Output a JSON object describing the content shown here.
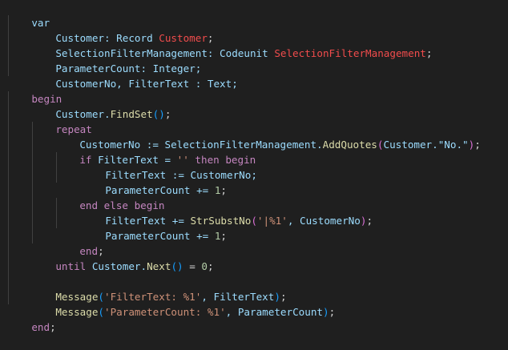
{
  "code": {
    "l1": {
      "var": "var"
    },
    "l2": {
      "a": "Customer: Record ",
      "b": "Customer",
      "c": ";"
    },
    "l3": {
      "a": "SelectionFilterManagement: Codeunit ",
      "b": "SelectionFilterManagement",
      "c": ";"
    },
    "l4": {
      "a": "ParameterCount: Integer;"
    },
    "l5": {
      "a": "CustomerNo, FilterText : Text;"
    },
    "l6": {
      "a": "begin"
    },
    "l7": {
      "a": "Customer.",
      "b": "FindSet",
      "c": "(",
      "d": ")",
      "e": ";"
    },
    "l8": {
      "a": "repeat"
    },
    "l9": {
      "a": "CustomerNo := SelectionFilterManagement.",
      "b": "AddQuotes",
      "c": "(",
      "d": "Customer.\"No.\"",
      "e": ")",
      "f": ";"
    },
    "l10": {
      "a": "if",
      "b": " FilterText = ",
      "c": "''",
      "d": " then ",
      "e": "begin"
    },
    "l11": {
      "a": "FilterText := CustomerNo;"
    },
    "l12": {
      "a": "ParameterCount += ",
      "b": "1",
      "c": ";"
    },
    "l13": {
      "a": "end else begin"
    },
    "l14": {
      "a": "FilterText += ",
      "b": "StrSubstNo",
      "c": "(",
      "d": "'|%1'",
      "e": ", CustomerNo",
      "f": ")",
      "g": ";"
    },
    "l15": {
      "a": "ParameterCount += ",
      "b": "1",
      "c": ";"
    },
    "l16": {
      "a": "end",
      "b": ";"
    },
    "l17": {
      "a": "until",
      "b": " Customer.",
      "c": "Next",
      "d": "(",
      "e": ")",
      "f": " = ",
      "g": "0",
      "h": ";"
    },
    "l18": {
      "a": "Message",
      "b": "(",
      "c": "'FilterText: %1'",
      "d": ", FilterText",
      "e": ")",
      "f": ";"
    },
    "l19": {
      "a": "Message",
      "b": "(",
      "c": "'ParameterCount: %1'",
      "d": ", ParameterCount",
      "e": ")",
      "f": ";"
    },
    "l20": {
      "a": "end",
      "b": ";"
    }
  },
  "colors": {
    "background": "#1f1f1f",
    "keyword": "#569cd6",
    "control": "#c586c0",
    "identifier": "#9cdcfe",
    "function": "#dcdcaa",
    "string": "#ce9178",
    "number": "#b5cea8",
    "object_name": "#f14c4c"
  }
}
